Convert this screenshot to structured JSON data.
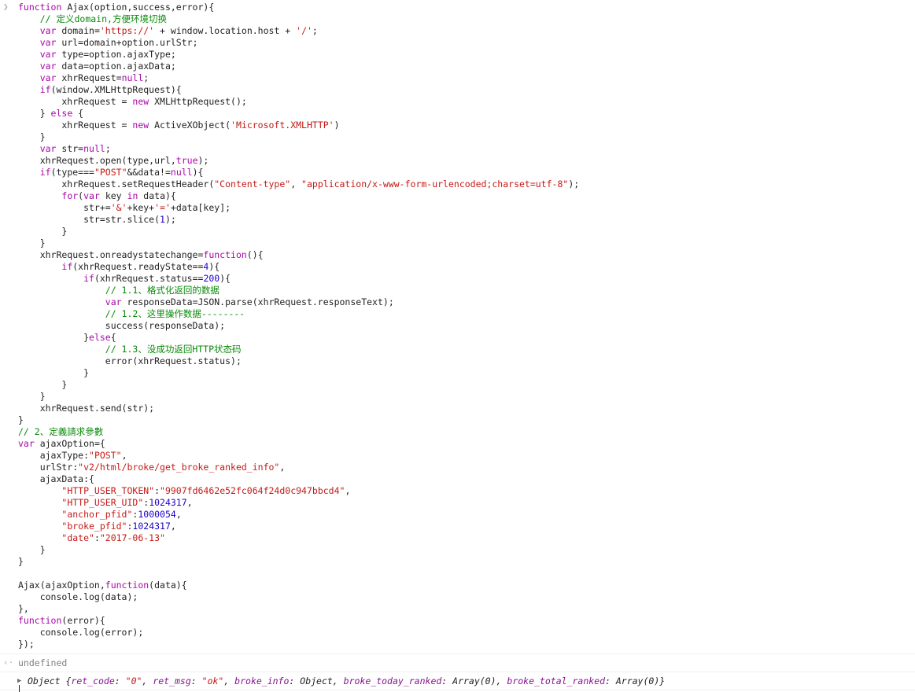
{
  "console": {
    "input_prompt": "❯",
    "code_lines": [
      [
        {
          "t": "kw",
          "v": "function"
        },
        {
          "t": "p",
          "v": " Ajax(option,success,error){"
        }
      ],
      [
        {
          "t": "p",
          "v": "    "
        },
        {
          "t": "cm",
          "v": "// 定义domain,方便环境切换"
        }
      ],
      [
        {
          "t": "p",
          "v": "    "
        },
        {
          "t": "kw",
          "v": "var"
        },
        {
          "t": "p",
          "v": " domain="
        },
        {
          "t": "str",
          "v": "'https://'"
        },
        {
          "t": "p",
          "v": " + window.location.host + "
        },
        {
          "t": "str",
          "v": "'/'"
        },
        {
          "t": "p",
          "v": ";"
        }
      ],
      [
        {
          "t": "p",
          "v": "    "
        },
        {
          "t": "kw",
          "v": "var"
        },
        {
          "t": "p",
          "v": " url=domain+option.urlStr;"
        }
      ],
      [
        {
          "t": "p",
          "v": "    "
        },
        {
          "t": "kw",
          "v": "var"
        },
        {
          "t": "p",
          "v": " type=option.ajaxType;"
        }
      ],
      [
        {
          "t": "p",
          "v": "    "
        },
        {
          "t": "kw",
          "v": "var"
        },
        {
          "t": "p",
          "v": " data=option.ajaxData;"
        }
      ],
      [
        {
          "t": "p",
          "v": "    "
        },
        {
          "t": "kw",
          "v": "var"
        },
        {
          "t": "p",
          "v": " xhrRequest="
        },
        {
          "t": "kw",
          "v": "null"
        },
        {
          "t": "p",
          "v": ";"
        }
      ],
      [
        {
          "t": "p",
          "v": "    "
        },
        {
          "t": "kw",
          "v": "if"
        },
        {
          "t": "p",
          "v": "(window.XMLHttpRequest){"
        }
      ],
      [
        {
          "t": "p",
          "v": "        xhrRequest = "
        },
        {
          "t": "kw",
          "v": "new"
        },
        {
          "t": "p",
          "v": " XMLHttpRequest();"
        }
      ],
      [
        {
          "t": "p",
          "v": "    } "
        },
        {
          "t": "kw",
          "v": "else"
        },
        {
          "t": "p",
          "v": " {"
        }
      ],
      [
        {
          "t": "p",
          "v": "        xhrRequest = "
        },
        {
          "t": "kw",
          "v": "new"
        },
        {
          "t": "p",
          "v": " ActiveXObject("
        },
        {
          "t": "str",
          "v": "'Microsoft.XMLHTTP'"
        },
        {
          "t": "p",
          "v": ")"
        }
      ],
      [
        {
          "t": "p",
          "v": "    }"
        }
      ],
      [
        {
          "t": "p",
          "v": "    "
        },
        {
          "t": "kw",
          "v": "var"
        },
        {
          "t": "p",
          "v": " str="
        },
        {
          "t": "kw",
          "v": "null"
        },
        {
          "t": "p",
          "v": ";"
        }
      ],
      [
        {
          "t": "p",
          "v": "    xhrRequest.open(type,url,"
        },
        {
          "t": "kw",
          "v": "true"
        },
        {
          "t": "p",
          "v": ");"
        }
      ],
      [
        {
          "t": "p",
          "v": "    "
        },
        {
          "t": "kw",
          "v": "if"
        },
        {
          "t": "p",
          "v": "(type==="
        },
        {
          "t": "str",
          "v": "\"POST\""
        },
        {
          "t": "p",
          "v": "&&data!="
        },
        {
          "t": "kw",
          "v": "null"
        },
        {
          "t": "p",
          "v": "){"
        }
      ],
      [
        {
          "t": "p",
          "v": "        xhrRequest.setRequestHeader("
        },
        {
          "t": "str",
          "v": "\"Content-type\""
        },
        {
          "t": "p",
          "v": ", "
        },
        {
          "t": "str",
          "v": "\"application/x-www-form-urlencoded;charset=utf-8\""
        },
        {
          "t": "p",
          "v": ");"
        }
      ],
      [
        {
          "t": "p",
          "v": "        "
        },
        {
          "t": "kw",
          "v": "for"
        },
        {
          "t": "p",
          "v": "("
        },
        {
          "t": "kw",
          "v": "var"
        },
        {
          "t": "p",
          "v": " key "
        },
        {
          "t": "kw",
          "v": "in"
        },
        {
          "t": "p",
          "v": " data){"
        }
      ],
      [
        {
          "t": "p",
          "v": "            str+="
        },
        {
          "t": "str",
          "v": "'&'"
        },
        {
          "t": "p",
          "v": "+key+"
        },
        {
          "t": "str",
          "v": "'='"
        },
        {
          "t": "p",
          "v": "+data[key];"
        }
      ],
      [
        {
          "t": "p",
          "v": "            str=str.slice("
        },
        {
          "t": "num",
          "v": "1"
        },
        {
          "t": "p",
          "v": ");"
        }
      ],
      [
        {
          "t": "p",
          "v": "        }"
        }
      ],
      [
        {
          "t": "p",
          "v": "    }"
        }
      ],
      [
        {
          "t": "p",
          "v": "    xhrRequest.onreadystatechange="
        },
        {
          "t": "kw",
          "v": "function"
        },
        {
          "t": "p",
          "v": "(){"
        }
      ],
      [
        {
          "t": "p",
          "v": "        "
        },
        {
          "t": "kw",
          "v": "if"
        },
        {
          "t": "p",
          "v": "(xhrRequest.readyState=="
        },
        {
          "t": "num",
          "v": "4"
        },
        {
          "t": "p",
          "v": "){"
        }
      ],
      [
        {
          "t": "p",
          "v": "            "
        },
        {
          "t": "kw",
          "v": "if"
        },
        {
          "t": "p",
          "v": "(xhrRequest.status=="
        },
        {
          "t": "num",
          "v": "200"
        },
        {
          "t": "p",
          "v": "){"
        }
      ],
      [
        {
          "t": "p",
          "v": "                "
        },
        {
          "t": "cm",
          "v": "// 1.1、格式化返回的数据"
        }
      ],
      [
        {
          "t": "p",
          "v": "                "
        },
        {
          "t": "kw",
          "v": "var"
        },
        {
          "t": "p",
          "v": " responseData=JSON.parse(xhrRequest.responseText);"
        }
      ],
      [
        {
          "t": "p",
          "v": "                "
        },
        {
          "t": "cm",
          "v": "// 1.2、这里操作数据--------"
        }
      ],
      [
        {
          "t": "p",
          "v": "                success(responseData);"
        }
      ],
      [
        {
          "t": "p",
          "v": "            }"
        },
        {
          "t": "kw",
          "v": "else"
        },
        {
          "t": "p",
          "v": "{"
        }
      ],
      [
        {
          "t": "p",
          "v": "                "
        },
        {
          "t": "cm",
          "v": "// 1.3、没成功返回HTTP状态码"
        }
      ],
      [
        {
          "t": "p",
          "v": "                error(xhrRequest.status);"
        }
      ],
      [
        {
          "t": "p",
          "v": "            }"
        }
      ],
      [
        {
          "t": "p",
          "v": "        }"
        }
      ],
      [
        {
          "t": "p",
          "v": "    }"
        }
      ],
      [
        {
          "t": "p",
          "v": "    xhrRequest.send(str);"
        }
      ],
      [
        {
          "t": "p",
          "v": "}"
        }
      ],
      [
        {
          "t": "cm",
          "v": "// 2、定義請求參數"
        }
      ],
      [
        {
          "t": "kw",
          "v": "var"
        },
        {
          "t": "p",
          "v": " ajaxOption={"
        }
      ],
      [
        {
          "t": "p",
          "v": "    ajaxType:"
        },
        {
          "t": "str",
          "v": "\"POST\""
        },
        {
          "t": "p",
          "v": ","
        }
      ],
      [
        {
          "t": "p",
          "v": "    urlStr:"
        },
        {
          "t": "str",
          "v": "\"v2/html/broke/get_broke_ranked_info\""
        },
        {
          "t": "p",
          "v": ","
        }
      ],
      [
        {
          "t": "p",
          "v": "    ajaxData:{"
        }
      ],
      [
        {
          "t": "p",
          "v": "        "
        },
        {
          "t": "str",
          "v": "\"HTTP_USER_TOKEN\""
        },
        {
          "t": "p",
          "v": ":"
        },
        {
          "t": "str",
          "v": "\"9907fd6462e52fc064f24d0c947bbcd4\""
        },
        {
          "t": "p",
          "v": ","
        }
      ],
      [
        {
          "t": "p",
          "v": "        "
        },
        {
          "t": "str",
          "v": "\"HTTP_USER_UID\""
        },
        {
          "t": "p",
          "v": ":"
        },
        {
          "t": "num",
          "v": "1024317"
        },
        {
          "t": "p",
          "v": ","
        }
      ],
      [
        {
          "t": "p",
          "v": "        "
        },
        {
          "t": "str",
          "v": "\"anchor_pfid\""
        },
        {
          "t": "p",
          "v": ":"
        },
        {
          "t": "num",
          "v": "1000054"
        },
        {
          "t": "p",
          "v": ","
        }
      ],
      [
        {
          "t": "p",
          "v": "        "
        },
        {
          "t": "str",
          "v": "\"broke_pfid\""
        },
        {
          "t": "p",
          "v": ":"
        },
        {
          "t": "num",
          "v": "1024317"
        },
        {
          "t": "p",
          "v": ","
        }
      ],
      [
        {
          "t": "p",
          "v": "        "
        },
        {
          "t": "str",
          "v": "\"date\""
        },
        {
          "t": "p",
          "v": ":"
        },
        {
          "t": "str",
          "v": "\"2017-06-13\""
        }
      ],
      [
        {
          "t": "p",
          "v": "    }"
        }
      ],
      [
        {
          "t": "p",
          "v": "}"
        }
      ],
      [
        {
          "t": "p",
          "v": ""
        }
      ],
      [
        {
          "t": "p",
          "v": "Ajax(ajaxOption,"
        },
        {
          "t": "kw",
          "v": "function"
        },
        {
          "t": "p",
          "v": "(data){"
        }
      ],
      [
        {
          "t": "p",
          "v": "    console.log(data);"
        }
      ],
      [
        {
          "t": "p",
          "v": "},"
        }
      ],
      [
        {
          "t": "kw",
          "v": "function"
        },
        {
          "t": "p",
          "v": "(error){"
        }
      ],
      [
        {
          "t": "p",
          "v": "    console.log(error);"
        }
      ],
      [
        {
          "t": "p",
          "v": "});"
        }
      ]
    ],
    "result_prompt": "‹·",
    "result_value": "undefined",
    "log_expander": "▶",
    "log_object": [
      {
        "t": "p",
        "v": "Object {"
      },
      {
        "t": "k",
        "v": "ret_code"
      },
      {
        "t": "p",
        "v": ": "
      },
      {
        "t": "s",
        "v": "\"0\""
      },
      {
        "t": "p",
        "v": ", "
      },
      {
        "t": "k",
        "v": "ret_msg"
      },
      {
        "t": "p",
        "v": ": "
      },
      {
        "t": "s",
        "v": "\"ok\""
      },
      {
        "t": "p",
        "v": ", "
      },
      {
        "t": "k",
        "v": "broke_info"
      },
      {
        "t": "p",
        "v": ": Object, "
      },
      {
        "t": "k",
        "v": "broke_today_ranked"
      },
      {
        "t": "p",
        "v": ": Array(0), "
      },
      {
        "t": "k",
        "v": "broke_total_ranked"
      },
      {
        "t": "p",
        "v": ": Array(0)}"
      }
    ]
  },
  "colors": {
    "keyword": "#a709a7",
    "string": "#c41a16",
    "number": "#1c00cf",
    "comment": "#0a8a0a",
    "object_key": "#881391"
  }
}
